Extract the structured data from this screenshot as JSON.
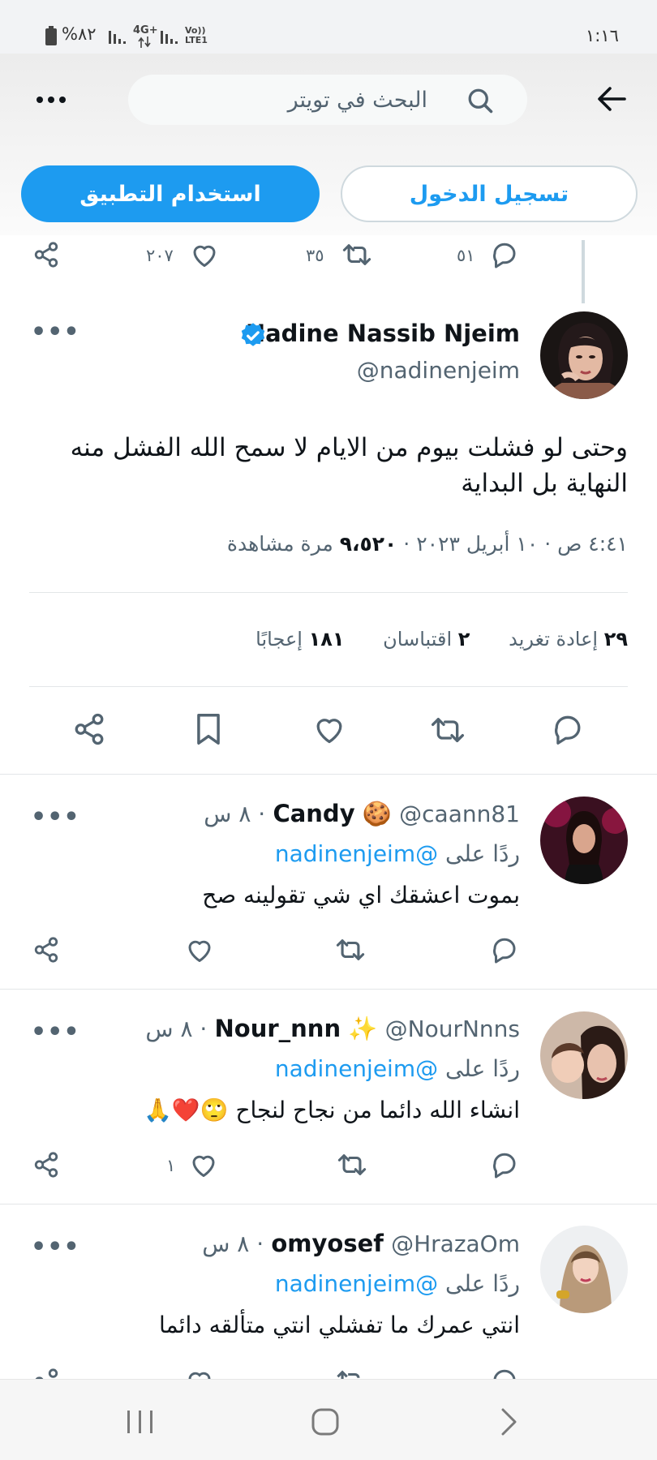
{
  "status_bar": {
    "time": "١:١٦",
    "battery": "%٨٢",
    "network": "4G+",
    "lte": "Vo)) LTE1"
  },
  "header": {
    "search_placeholder": "البحث في تويتر",
    "back_icon": "arrow-left-icon",
    "more_icon": "more-horizontal-icon"
  },
  "auth": {
    "use_app_label": "استخدام التطبيق",
    "login_label": "تسجيل الدخول"
  },
  "prev_tweet_actions": {
    "replies": "٥١",
    "retweets": "٣٥",
    "likes": "٢٠٧"
  },
  "tweet": {
    "author_name": "Nadine Nassib Njeim",
    "author_handle": "@nadinenjeim",
    "verified": true,
    "text_line1": "وحتى لو فشلت بيوم من الايام لا سمح الله الفشل منه",
    "text_line2": "النهاية بل البداية",
    "time": "٤:٤١ ص",
    "date": "١٠ أبريل ٢٠٢٣",
    "views_count": "٩،٥٢٠",
    "views_label": "مرة مشاهدة",
    "separator": "·",
    "retweets_count": "٢٩",
    "retweets_label": "إعادة تغريد",
    "quotes_count": "٢",
    "quotes_label": "اقتباسان",
    "likes_count": "١٨١",
    "likes_label": "إعجابًا"
  },
  "replies": [
    {
      "name": "Candy",
      "emoji": "🍪",
      "handle": "@caann81",
      "time": "· ٨ س",
      "reply_to_prefix": "ردًا على",
      "reply_to": "@nadinenjeim",
      "text": "بموت اعشقك اي شي تقولينه صح",
      "likes": ""
    },
    {
      "name": "Nour_nnn",
      "emoji": "✨",
      "handle": "@NourNnns",
      "time": "· ٨ س",
      "reply_to_prefix": "ردًا على",
      "reply_to": "@nadinenjeim",
      "text": "انشاء الله دائما من نجاح لنجاح",
      "text_emoji": "🙄❤️🙏",
      "likes": "١"
    },
    {
      "name": "omyosef",
      "emoji": "",
      "handle": "@HrazaOm",
      "time": "· ٨ س",
      "reply_to_prefix": "ردًا على",
      "reply_to": "@nadinenjeim",
      "text": "انتي عمرك ما تفشلي انتي متألقه دائما",
      "likes": ""
    }
  ],
  "colors": {
    "accent": "#1d9bf0",
    "text": "#0f1419",
    "secondary": "#536471",
    "divider": "#e3e6e8"
  }
}
